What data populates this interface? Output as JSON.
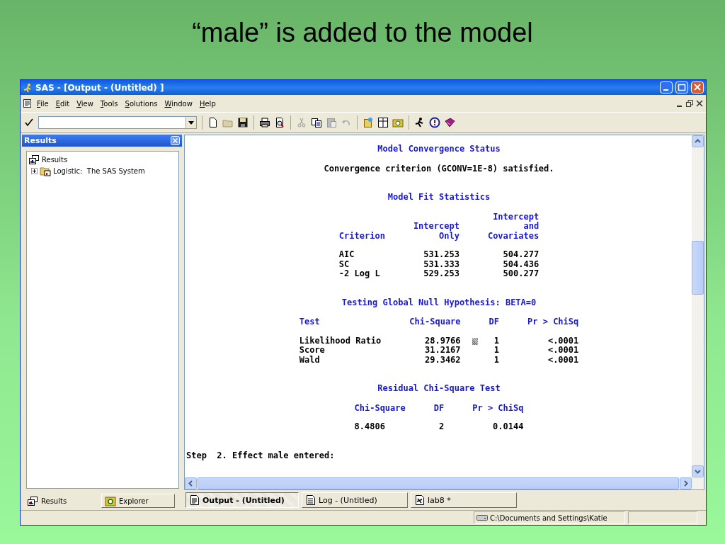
{
  "slide": {
    "title": "“male” is added to the model"
  },
  "window": {
    "title": "SAS - [Output - (Untitled) ]"
  },
  "menu": [
    {
      "label": "File"
    },
    {
      "label": "Edit"
    },
    {
      "label": "View"
    },
    {
      "label": "Tools"
    },
    {
      "label": "Solutions"
    },
    {
      "label": "Window"
    },
    {
      "label": "Help"
    }
  ],
  "results_pane": {
    "title": "Results",
    "tree": [
      {
        "label": "Results",
        "children": [
          {
            "label": "Logistic:  The SAS System",
            "expanded": false
          }
        ]
      }
    ],
    "tabs": [
      {
        "label": "Results",
        "selected": true
      },
      {
        "label": "Explorer",
        "selected": false
      }
    ]
  },
  "output": {
    "sections": [
      {
        "kind": "heading",
        "text": "Model Convergence Status"
      },
      {
        "kind": "note",
        "text": "Convergence criterion (GCONV=1E-8) satisfied."
      },
      {
        "kind": "heading",
        "text": "Model Fit Statistics"
      },
      {
        "kind": "table",
        "columns": [
          "Criterion",
          "Intercept\nOnly",
          "Intercept\nand\nCovariates"
        ],
        "rows": [
          [
            "AIC",
            "531.253",
            "504.277"
          ],
          [
            "SC",
            "531.333",
            "504.436"
          ],
          [
            "-2 Log L",
            "529.253",
            "500.277"
          ]
        ]
      },
      {
        "kind": "heading",
        "text": "Testing Global Null Hypothesis: BETA=0"
      },
      {
        "kind": "table",
        "columns": [
          "Test",
          "Chi-Square",
          "DF",
          "Pr > ChiSq"
        ],
        "rows": [
          [
            "Likelihood Ratio",
            "28.9766",
            "1",
            "<.0001"
          ],
          [
            "Score",
            "31.2167",
            "1",
            "<.0001"
          ],
          [
            "Wald",
            "29.3462",
            "1",
            "<.0001"
          ]
        ]
      },
      {
        "kind": "heading",
        "text": "Residual Chi-Square Test"
      },
      {
        "kind": "table",
        "columns": [
          "Chi-Square",
          "DF",
          "Pr > ChiSq"
        ],
        "rows": [
          [
            "8.4806",
            "2",
            "0.0144"
          ]
        ]
      },
      {
        "kind": "line",
        "text": "Step  2. Effect male entered:"
      }
    ]
  },
  "window_tabs": [
    {
      "label": "Output - (Untitled)",
      "selected": true
    },
    {
      "label": "Log - (Untitled)",
      "selected": false
    },
    {
      "label": "lab8 *",
      "selected": false
    }
  ],
  "status_bar": {
    "path": "C:\\Documents and Settings\\Katie"
  }
}
